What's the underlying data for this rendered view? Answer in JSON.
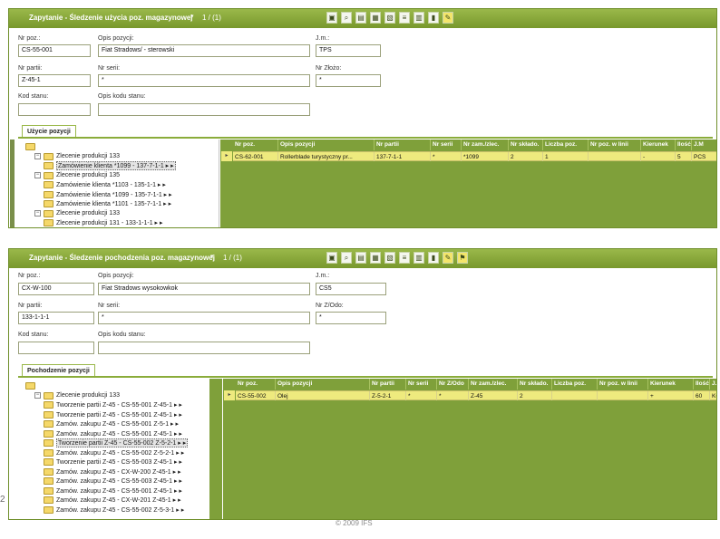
{
  "panel1": {
    "title": "Zapytanie - Śledzenie użycia poz. magazynowej",
    "record": "1 / (1)",
    "fields": {
      "nr_poz_label": "Nr poz.:",
      "nr_poz_value": "CS-55-001",
      "opis_label": "Opis pozycji:",
      "opis_value": "Fiat Stradows/ - sterowski",
      "jm_label": "J.m.:",
      "jm_value": "TPS",
      "nr_partii_label": "Nr partii:",
      "nr_partii_value": "Z-45-1",
      "nr_serii_label": "Nr serii:",
      "nr_serii_value": "*",
      "nr_zlozo_label": "Nr Złożo:",
      "nr_zlozo_value": "*",
      "kod_stanu_label": "Kod stanu:",
      "kod_stanu_value": "",
      "opis_kodu_label": "Opis kodu stanu:",
      "opis_kodu_value": ""
    },
    "tab": "Użycie pozycji",
    "tree": [
      {
        "indent": 0,
        "label": "",
        "toggle": "",
        "sel": false
      },
      {
        "indent": 1,
        "label": "Zlecenie produkcji 133",
        "toggle": "−",
        "sel": false
      },
      {
        "indent": 2,
        "label": "Zamówienie klienta *1099 - 137-7-1-1 ▸ ▸",
        "toggle": "",
        "sel": true
      },
      {
        "indent": 1,
        "label": "Zlecenie produkcji 135",
        "toggle": "−",
        "sel": false
      },
      {
        "indent": 2,
        "label": "Zamówienie klienta *1103 - 135-1-1 ▸ ▸",
        "toggle": "",
        "sel": false
      },
      {
        "indent": 2,
        "label": "Zamówienie klienta *1099 - 135-7-1-1 ▸ ▸",
        "toggle": "",
        "sel": false
      },
      {
        "indent": 2,
        "label": "Zamówienie klienta *1101 - 135-7-1-1 ▸ ▸",
        "toggle": "",
        "sel": false
      },
      {
        "indent": 1,
        "label": "Zlecenie produkcji 133",
        "toggle": "−",
        "sel": false
      },
      {
        "indent": 2,
        "label": "Zlecenie produkcji 131 - 133-1-1-1 ▸ ▸",
        "toggle": "",
        "sel": false
      },
      {
        "indent": 3,
        "label": "",
        "toggle": "",
        "sel": false
      }
    ],
    "grid": {
      "headers": [
        "Nr poz.",
        "Opis pozycji",
        "Nr partii",
        "Nr serii",
        "Nr zam./zlec.",
        "Nr składo.",
        "Liczba poz.",
        "Nr poz. w linii",
        "Kierunek",
        "Ilość",
        "J.M"
      ],
      "row": [
        "CS-62-001",
        "Rollerblade turystyczny pr...",
        "137-7-1-1",
        "*",
        "*1099",
        "2",
        "1",
        "",
        "-",
        "5",
        "PCS"
      ]
    }
  },
  "panel2": {
    "title": "Zapytanie - Śledzenie pochodzenia poz. magazynowej",
    "record": "1 / (1)",
    "fields": {
      "nr_poz_label": "Nr poz.:",
      "nr_poz_value": "CX-W-100",
      "opis_label": "Opis pozycji:",
      "opis_value": "Fiat Stradows wysokowkok",
      "jm_label": "J.m.:",
      "jm_value": "CS5",
      "nr_partii_label": "Nr partii:",
      "nr_partii_value": "133-1-1-1",
      "nr_serii_label": "Nr serii:",
      "nr_serii_value": "*",
      "nr_zlozo_label": "Nr Z/Odo:",
      "nr_zlozo_value": "*",
      "kod_stanu_label": "Kod stanu:",
      "kod_stanu_value": "",
      "opis_kodu_label": "Opis kodu stanu:",
      "opis_kodu_value": ""
    },
    "tab": "Pochodzenie pozycji",
    "tree": [
      {
        "indent": 0,
        "label": "",
        "toggle": "",
        "sel": false
      },
      {
        "indent": 1,
        "label": "Zlecenie produkcji 133",
        "toggle": "−",
        "sel": false
      },
      {
        "indent": 2,
        "label": "Tworzenie partii Z-45 - CS-55-001 Z-45-1 ▸ ▸",
        "toggle": "",
        "sel": false
      },
      {
        "indent": 2,
        "label": "Tworzenie partii Z-45 - CS-55-001 Z-45-1 ▸ ▸",
        "toggle": "",
        "sel": false
      },
      {
        "indent": 2,
        "label": "Zamów. zakupu Z-45 - CS-55-001 Z-5-1 ▸ ▸",
        "toggle": "",
        "sel": false
      },
      {
        "indent": 2,
        "label": "Zamów. zakupu Z-45 - CS-55-001 Z-45-1 ▸ ▸",
        "toggle": "",
        "sel": false
      },
      {
        "indent": 2,
        "label": "Tworzenie partii Z-45 - CS-55-002 Z-5-2-1 ▸ ▸",
        "toggle": "",
        "sel": true
      },
      {
        "indent": 2,
        "label": "Zamów. zakupu Z-45 - CS-55-002 Z-5-2-1 ▸ ▸",
        "toggle": "",
        "sel": false
      },
      {
        "indent": 2,
        "label": "Tworzenie partii Z-45 - CS-55-003 Z-45-1 ▸ ▸",
        "toggle": "",
        "sel": false
      },
      {
        "indent": 2,
        "label": "Zamów. zakupu Z-45 - CX-W-200 Z-45-1 ▸ ▸",
        "toggle": "",
        "sel": false
      },
      {
        "indent": 2,
        "label": "Zamów. zakupu Z-45 - CS-55-003 Z-45-1 ▸ ▸",
        "toggle": "",
        "sel": false
      },
      {
        "indent": 2,
        "label": "Zamów. zakupu Z-45 - CS-55-001 Z-45-1 ▸ ▸",
        "toggle": "",
        "sel": false
      },
      {
        "indent": 2,
        "label": "Zamów. zakupu Z-45 - CX-W-201 Z-45-1 ▸ ▸",
        "toggle": "",
        "sel": false
      },
      {
        "indent": 2,
        "label": "Zamów. zakupu Z-45 - CS-55-002 Z-5-3-1 ▸ ▸",
        "toggle": "",
        "sel": false
      }
    ],
    "grid": {
      "headers": [
        "Nr poz.",
        "Opis pozycji",
        "Nr partii",
        "Nr serii",
        "Nr Z/Odo",
        "Nr zam./zlec.",
        "Nr składo.",
        "Liczba poz.",
        "Nr poz. w linii",
        "Kierunek",
        "Ilość",
        "J.M"
      ],
      "row": [
        "CS-55-002",
        "Olej",
        "Z-5-2-1",
        "*",
        "*",
        "Z-45",
        "2",
        "",
        "",
        "+",
        "60",
        "KG"
      ]
    }
  },
  "footer": "© 2009 IFS",
  "page_number": "2"
}
